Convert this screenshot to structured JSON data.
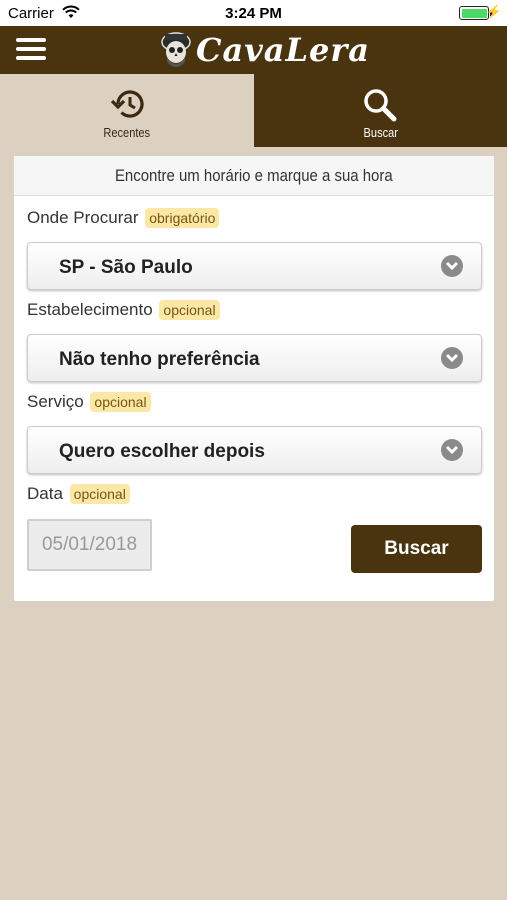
{
  "status_bar": {
    "carrier": "Carrier",
    "time": "3:24 PM",
    "battery_level": 1.0,
    "battery_color": "#4cd964"
  },
  "header": {
    "menu_icon": "hamburger-icon",
    "logo_text": "CavaLera",
    "bg_color": "#4a3410"
  },
  "tabs": [
    {
      "label": "Recentes",
      "icon": "history-icon",
      "active": false
    },
    {
      "label": "Buscar",
      "icon": "search-icon",
      "active": true
    }
  ],
  "form": {
    "title": "Encontre um horário e marque a sua hora",
    "fields": [
      {
        "label": "Onde Procurar",
        "badge": "obrigatório",
        "value": "SP - São Paulo"
      },
      {
        "label": "Estabelecimento",
        "badge": "opcional",
        "value": "Não tenho preferência"
      },
      {
        "label": "Serviço",
        "badge": "opcional",
        "value": "Quero escolher depois"
      },
      {
        "label": "Data",
        "badge": "opcional",
        "value": "05/01/2018"
      }
    ],
    "submit_label": "Buscar"
  }
}
